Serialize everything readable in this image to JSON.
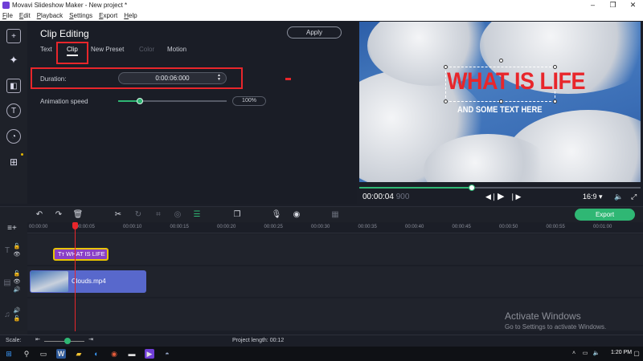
{
  "window": {
    "title": "Movavi Slideshow Maker - New project *",
    "buttons": [
      "–",
      "❐",
      "✕"
    ]
  },
  "menu": [
    "File",
    "Edit",
    "Playback",
    "Settings",
    "Export",
    "Help"
  ],
  "leftbar": {
    "tools": [
      "import-icon",
      "magic-wand-icon",
      "transitions-icon",
      "titles-icon",
      "stickers-icon",
      "more-tools-icon"
    ]
  },
  "clip_editing": {
    "title": "Clip Editing",
    "apply_label": "Apply",
    "tabs": [
      {
        "label": "Text",
        "state": "normal"
      },
      {
        "label": "Clip",
        "state": "active"
      },
      {
        "label": "New Preset",
        "state": "normal"
      },
      {
        "label": "Color",
        "state": "disabled"
      },
      {
        "label": "Motion",
        "state": "normal"
      }
    ],
    "duration_label": "Duration:",
    "duration_value": "0:00:06:000",
    "animation_speed_label": "Animation speed",
    "animation_speed_value": "100%",
    "animation_speed_level": 0.2
  },
  "preview": {
    "headline": "WHAT IS LIFE",
    "subline": "AND SOME TEXT HERE",
    "timecode": "00:00:04",
    "timecode_ms": "900",
    "playback_progress": 0.4,
    "aspect": "16:9 ▾"
  },
  "timeline": {
    "export_label": "Export",
    "ruler": [
      "00:00:00",
      "00:00:05",
      "00:00:10",
      "00:00:15",
      "00:00:20",
      "00:00:25",
      "00:00:30",
      "00:00:35",
      "00:00:40",
      "00:00:45",
      "00:00:50",
      "00:00:55",
      "00:01:00"
    ],
    "title_clip": "WHAT IS LIFE",
    "video_clip": "Clouds.mp4"
  },
  "status": {
    "scale_label": "Scale:",
    "project_length": "Project length:  00:12"
  },
  "watermark": {
    "line1": "Activate Windows",
    "line2": "Go to Settings to activate Windows."
  },
  "taskbar": {
    "clock": "1:20 PM"
  },
  "colors": {
    "accent_green": "#2fb774",
    "highlight_red": "#e8262b",
    "title_clip_purple": "#8a3fc6",
    "video_clip_blue": "#5868cc"
  }
}
